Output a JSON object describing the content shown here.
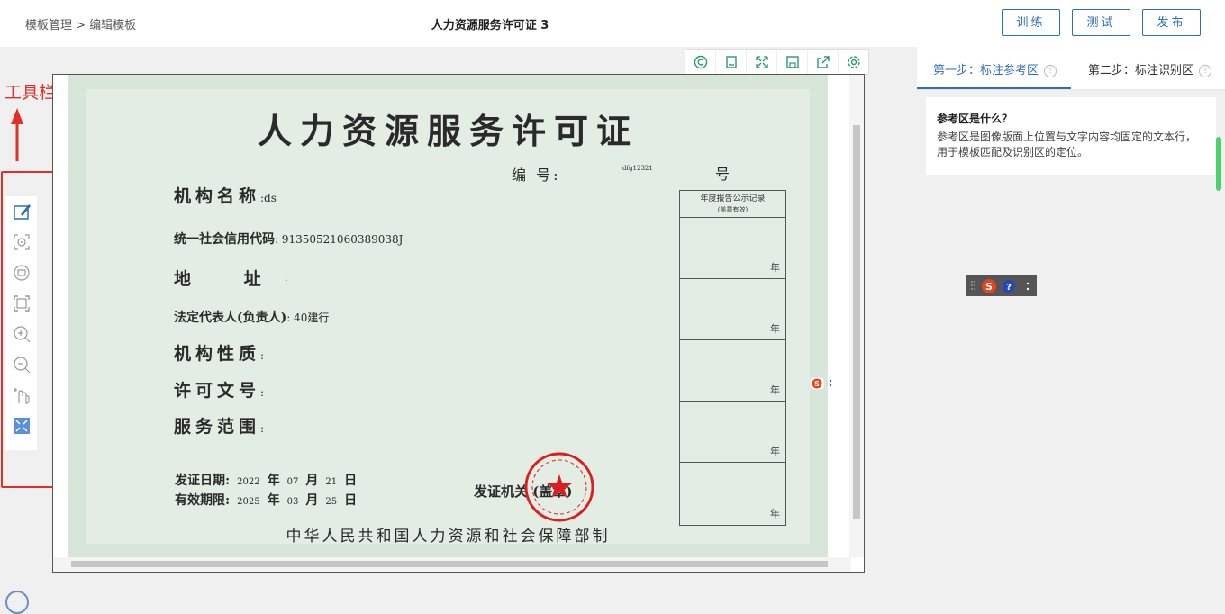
{
  "header": {
    "breadcrumb": "模板管理 > 编辑模板",
    "title": "人力资源服务许可证 3",
    "btn_train": "训练",
    "btn_test": "测试",
    "btn_publish": "发布"
  },
  "image_toolbar": [
    "copyright-icon",
    "page-icon",
    "fullscreen-icon",
    "save-icon",
    "export-icon",
    "settings-icon"
  ],
  "annotation": {
    "label": "工具栏",
    "color": "#e0302a"
  },
  "side_tools": [
    "draw-box-icon",
    "target-select-icon",
    "image-rotate-icon",
    "fit-frame-icon",
    "zoom-in-icon",
    "zoom-out-icon",
    "pan-hand-icon",
    "collapse-icon"
  ],
  "certificate": {
    "title": "人力资源服务许可证",
    "number_label": "编 号:",
    "number_value": "dfg12321",
    "number_suffix": "号",
    "org_name_label": "机构名称",
    "org_name_value": ":ds",
    "credit_code_label": "统一社会信用代码",
    "credit_code_value": ": 91350521060389038J",
    "address_label": "地  址",
    "address_value": ":",
    "legal_rep_label": "法定代表人(负责人)",
    "legal_rep_value": ": 40建行",
    "org_type_label": "机构性质",
    "org_type_value": ":",
    "permit_no_label": "许可文号",
    "permit_no_value": ":",
    "scope_label": "服务范围",
    "scope_value": ":",
    "record_header": "年度报告公示记录",
    "record_subheader": "(盖章有效)",
    "record_year_label": "年",
    "record_rows": 5,
    "issue_date_label": "发证日期:",
    "issue_year": "2022",
    "issue_month": "07",
    "issue_day": "21",
    "valid_label": "有效期限:",
    "valid_year": "2025",
    "valid_month": "03",
    "valid_day": "25",
    "unit_year": "年",
    "unit_month": "月",
    "unit_day": "日",
    "issuer_label": "发证机关 (盖章)",
    "footer": "中华人民共和国人力资源和社会保障部制"
  },
  "right_panel": {
    "step1": "第一步：标注参考区",
    "step2": "第二步：标注识别区",
    "info_title": "参考区是什么？",
    "info_text": "参考区是图像版面上位置与文字内容均固定的文本行，用于模板匹配及识别区的定位。"
  },
  "colors": {
    "accent": "#2f6fb6",
    "annotation_red": "#e0302a",
    "cert_bg": "#e3ede4"
  }
}
